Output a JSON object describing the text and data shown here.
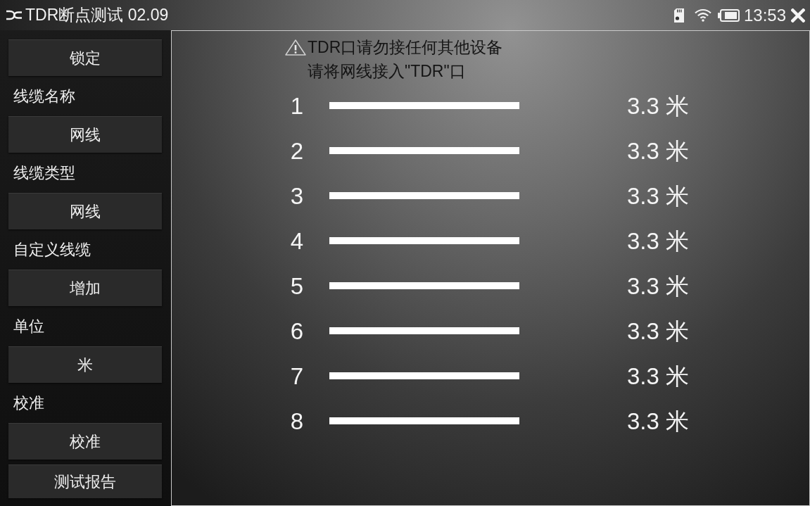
{
  "title_bar": {
    "title": "TDR断点测试 02.09",
    "time": "13:53"
  },
  "sidebar": {
    "items": [
      {
        "kind": "button",
        "label": "锁定"
      },
      {
        "kind": "label",
        "label": "线缆名称"
      },
      {
        "kind": "button",
        "label": "网线"
      },
      {
        "kind": "label",
        "label": "线缆类型"
      },
      {
        "kind": "button",
        "label": "网线"
      },
      {
        "kind": "label",
        "label": "自定义线缆"
      },
      {
        "kind": "button",
        "label": "增加"
      },
      {
        "kind": "label",
        "label": "单位"
      },
      {
        "kind": "button",
        "label": "米"
      },
      {
        "kind": "label",
        "label": "校准"
      },
      {
        "kind": "button",
        "label": "校准"
      },
      {
        "kind": "button",
        "label": "测试报告"
      }
    ]
  },
  "notice": {
    "warning": "TDR口请勿接任何其他设备",
    "instruction": "请将网线接入\"TDR\"口"
  },
  "pairs": [
    {
      "number": "1",
      "length": "3.3 米"
    },
    {
      "number": "2",
      "length": "3.3 米"
    },
    {
      "number": "3",
      "length": "3.3 米"
    },
    {
      "number": "4",
      "length": "3.3 米"
    },
    {
      "number": "5",
      "length": "3.3 米"
    },
    {
      "number": "6",
      "length": "3.3 米"
    },
    {
      "number": "7",
      "length": "3.3 米"
    },
    {
      "number": "8",
      "length": "3.3 米"
    }
  ]
}
